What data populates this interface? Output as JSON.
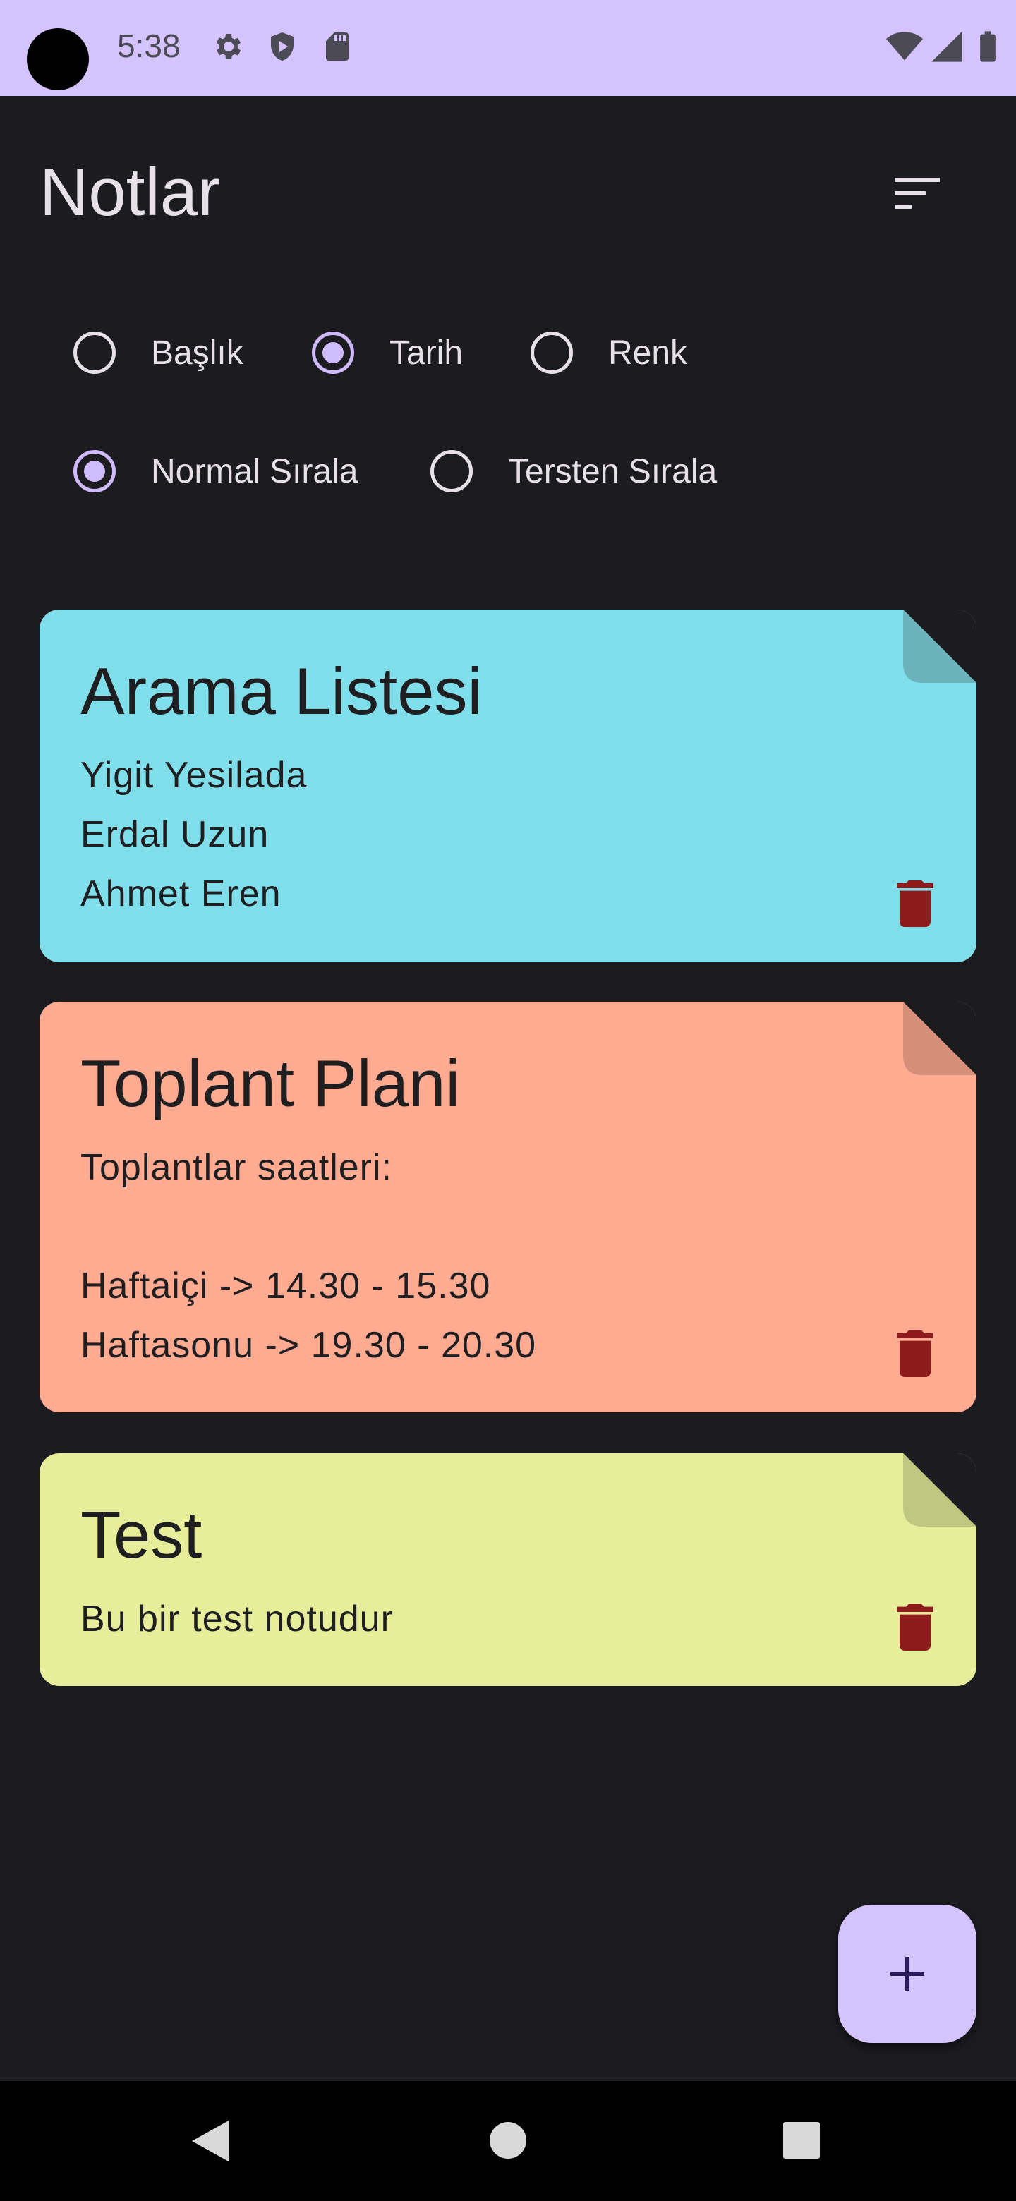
{
  "status_bar": {
    "time": "5:38",
    "left_icons": [
      "gear-icon",
      "shield-icon",
      "sd-card-icon"
    ],
    "right_icons": [
      "wifi-icon",
      "signal-icon",
      "battery-icon"
    ]
  },
  "header": {
    "title": "Notlar",
    "sort_icon": "sort-icon"
  },
  "sort_by": {
    "options": [
      {
        "label": "Başlık",
        "checked": false
      },
      {
        "label": "Tarih",
        "checked": true
      },
      {
        "label": "Renk",
        "checked": false
      }
    ]
  },
  "sort_order": {
    "options": [
      {
        "label": "Normal Sırala",
        "checked": true
      },
      {
        "label": "Tersten Sırala",
        "checked": false
      }
    ]
  },
  "notes": [
    {
      "title": "Arama Listesi",
      "body": "Yigit Yesilada\nErdal Uzun\nAhmet Eren",
      "color": "#80deea",
      "fold_color": "#6ab3bd"
    },
    {
      "title": "Toplant Plani",
      "body": "Toplantlar saatleri:\n\nHaftaiçi -> 14.30 - 15.30\nHaftasonu -> 19.30 - 20.30",
      "color": "#ffab91",
      "fold_color": "#d48e79"
    },
    {
      "title": "Test",
      "body": "Bu bir test notudur",
      "color": "#e6ee9b",
      "fold_color": "#c0c780"
    }
  ],
  "colors": {
    "background": "#1c1b20",
    "accent": "#cfbcff",
    "trash": "#8e1b1b"
  },
  "fab": {
    "icon": "plus-icon"
  },
  "nav_bar": {
    "icons": [
      "back-icon",
      "home-icon",
      "recents-icon"
    ]
  }
}
